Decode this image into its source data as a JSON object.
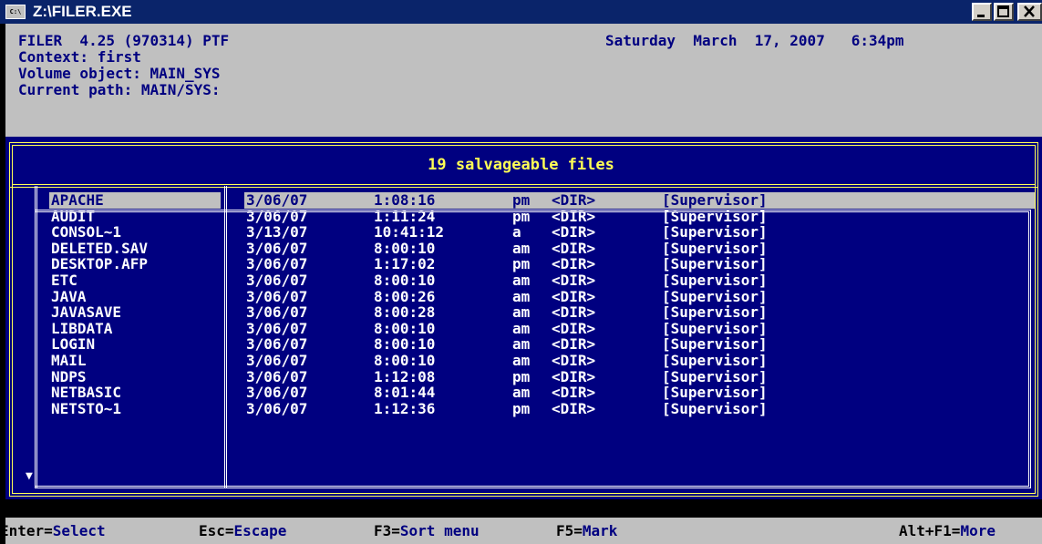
{
  "window": {
    "title": "Z:\\FILER.EXE",
    "icon": "console-icon",
    "buttons": {
      "minimize": "_",
      "maximize": "□",
      "close": "x"
    }
  },
  "header": {
    "app_version": "FILER  4.25 (970314) PTF",
    "date": "Saturday  March  17, 2007   6:34pm",
    "context": "Context: first",
    "volume": "Volume object: MAIN_SYS",
    "path": "Current path: MAIN/SYS:"
  },
  "panel": {
    "title": "19 salvageable files"
  },
  "files": [
    {
      "name": "APACHE",
      "date": "3/06/07",
      "time": "1:08:16",
      "ampm": "pm",
      "type": "<DIR>",
      "owner": "[Supervisor]"
    },
    {
      "name": "AUDIT",
      "date": "3/06/07",
      "time": "1:11:24",
      "ampm": "pm",
      "type": "<DIR>",
      "owner": "[Supervisor]"
    },
    {
      "name": "CONSOL~1",
      "date": "3/13/07",
      "time": "10:41:12",
      "ampm": "a",
      "type": "<DIR>",
      "owner": "[Supervisor]"
    },
    {
      "name": "DELETED.SAV",
      "date": "3/06/07",
      "time": "8:00:10",
      "ampm": "am",
      "type": "<DIR>",
      "owner": "[Supervisor]"
    },
    {
      "name": "DESKTOP.AFP",
      "date": "3/06/07",
      "time": "1:17:02",
      "ampm": "pm",
      "type": "<DIR>",
      "owner": "[Supervisor]"
    },
    {
      "name": "ETC",
      "date": "3/06/07",
      "time": "8:00:10",
      "ampm": "am",
      "type": "<DIR>",
      "owner": "[Supervisor]"
    },
    {
      "name": "JAVA",
      "date": "3/06/07",
      "time": "8:00:26",
      "ampm": "am",
      "type": "<DIR>",
      "owner": "[Supervisor]"
    },
    {
      "name": "JAVASAVE",
      "date": "3/06/07",
      "time": "8:00:28",
      "ampm": "am",
      "type": "<DIR>",
      "owner": "[Supervisor]"
    },
    {
      "name": "LIBDATA",
      "date": "3/06/07",
      "time": "8:00:10",
      "ampm": "am",
      "type": "<DIR>",
      "owner": "[Supervisor]"
    },
    {
      "name": "LOGIN",
      "date": "3/06/07",
      "time": "8:00:10",
      "ampm": "am",
      "type": "<DIR>",
      "owner": "[Supervisor]"
    },
    {
      "name": "MAIL",
      "date": "3/06/07",
      "time": "8:00:10",
      "ampm": "am",
      "type": "<DIR>",
      "owner": "[Supervisor]"
    },
    {
      "name": "NDPS",
      "date": "3/06/07",
      "time": "1:12:08",
      "ampm": "pm",
      "type": "<DIR>",
      "owner": "[Supervisor]"
    },
    {
      "name": "NETBASIC",
      "date": "3/06/07",
      "time": "8:01:44",
      "ampm": "am",
      "type": "<DIR>",
      "owner": "[Supervisor]"
    },
    {
      "name": "NETSTO~1",
      "date": "3/06/07",
      "time": "1:12:36",
      "ampm": "pm",
      "type": "<DIR>",
      "owner": "[Supervisor]"
    }
  ],
  "selected_index": 0,
  "scroll_arrow": "▼",
  "status": {
    "enter_key": "Enter=",
    "enter_val": "Select",
    "esc_key": "Esc=",
    "esc_val": "Escape",
    "f3_key": "F3=",
    "f3_val": "Sort menu",
    "f5_key": "F5=",
    "f5_val": "Mark",
    "alt_key": "Alt+F1=",
    "alt_val": "More"
  },
  "colors": {
    "title_bar": "#0a246a",
    "console_gray": "#c0c0c0",
    "console_blue": "#000080",
    "frame_yellow": "#ffff55",
    "text_white": "#ffffff"
  }
}
